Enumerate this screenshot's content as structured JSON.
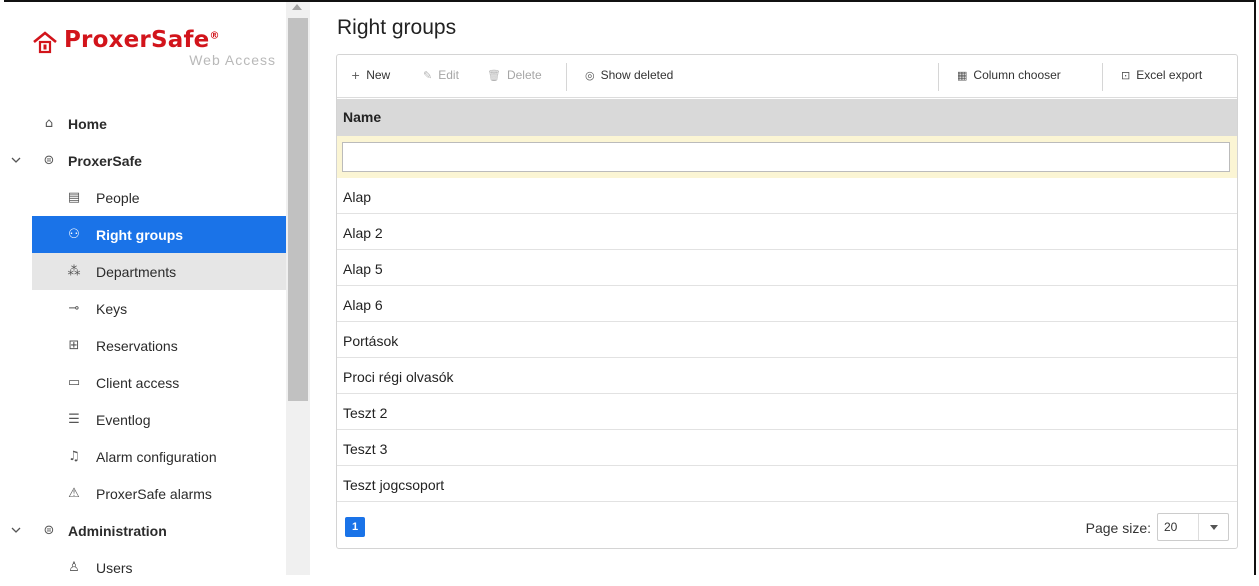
{
  "app": {
    "brand": "ProxerSafe",
    "brand_reg": "®",
    "brand_sub": "Web Access"
  },
  "sidebar": {
    "items": [
      {
        "label": "Home",
        "icon": "home-icon"
      },
      {
        "label": "ProxerSafe",
        "icon": "layers-icon"
      },
      {
        "label": "People",
        "icon": "id-card-icon"
      },
      {
        "label": "Right groups",
        "icon": "group-icon"
      },
      {
        "label": "Departments",
        "icon": "org-chart-icon"
      },
      {
        "label": "Keys",
        "icon": "key-icon"
      },
      {
        "label": "Reservations",
        "icon": "book-icon"
      },
      {
        "label": "Client access",
        "icon": "keyboard-icon"
      },
      {
        "label": "Eventlog",
        "icon": "list-icon"
      },
      {
        "label": "Alarm configuration",
        "icon": "bell-icon"
      },
      {
        "label": "ProxerSafe alarms",
        "icon": "warning-icon"
      },
      {
        "label": "Administration",
        "icon": "layers-icon"
      },
      {
        "label": "Users",
        "icon": "user-icon"
      }
    ]
  },
  "main": {
    "title": "Right groups",
    "toolbar": {
      "new": "New",
      "edit": "Edit",
      "delete": "Delete",
      "show_deleted": "Show deleted",
      "column_chooser": "Column chooser",
      "excel_export": "Excel export"
    },
    "grid": {
      "column_header": "Name",
      "filter_value": "",
      "rows": [
        "Alap",
        "Alap 2",
        "Alap 5",
        "Alap 6",
        "Portások",
        "Proci régi olvasók",
        "Teszt 2",
        "Teszt 3",
        "Teszt jogcsoport"
      ]
    },
    "pager": {
      "current_page": "1",
      "page_size_label": "Page size:",
      "page_size_value": "20"
    }
  },
  "colors": {
    "accent": "#1a73e8",
    "brand_red": "#d2141b",
    "filter_row_bg": "#fbf5d4",
    "header_bg": "#d9d9d9"
  }
}
